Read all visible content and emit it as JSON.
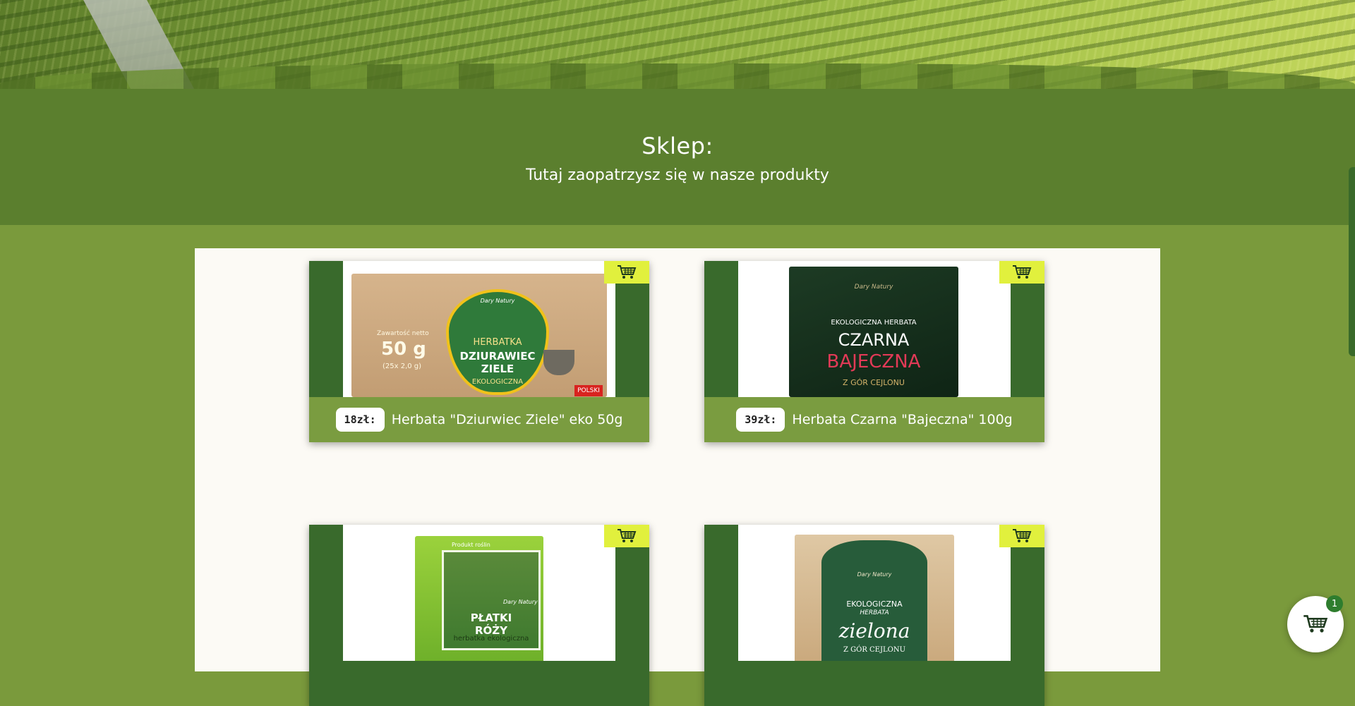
{
  "header": {
    "title": "Sklep:",
    "subtitle": "Tutaj zaopatrzysz się w nasze produkty"
  },
  "products": [
    {
      "price": "18zł:",
      "name": "Herbata \"Dziurwiec Ziele\" eko 50g",
      "package": {
        "brand": "Dary Natury",
        "line1": "HERBATKA",
        "line2": "DZIURAWIEC",
        "line3": "ZIELE",
        "line4": "EKOLOGICZNA",
        "weight": "50 g",
        "weight_note": "(25x 2,0 g)",
        "net_label": "Zawartość netto",
        "flag": "POLSKI"
      }
    },
    {
      "price": "39zł:",
      "name": "Herbata Czarna \"Bajeczna\" 100g",
      "package": {
        "brand": "Dary Natury",
        "line1": "EKOLOGICZNA HERBATA",
        "line2": "CZARNA",
        "line3": "BAJECZNA",
        "line4": "Z GÓR CEJLONU"
      }
    },
    {
      "price": "",
      "name": "",
      "package": {
        "brand": "Dary Natury",
        "tag": "Produkt roślin",
        "line1": "PŁATKI",
        "line2": "RÓŻY",
        "line3": "herbatka ekologiczna"
      }
    },
    {
      "price": "",
      "name": "",
      "package": {
        "brand": "Dary Natury",
        "line1": "EKOLOGICZNA",
        "line2": "HERBATA",
        "line3": "zielona",
        "line4": "Z GÓR CEJLONU"
      }
    }
  ],
  "cart": {
    "count": "1",
    "icon": "cart-icon"
  },
  "colors": {
    "title_band": "#5b7f2e",
    "page_bg": "#7a9a3c",
    "card_dark": "#396a2c",
    "card_caption": "#7a9c40",
    "cart_tab": "#e1f03d"
  }
}
